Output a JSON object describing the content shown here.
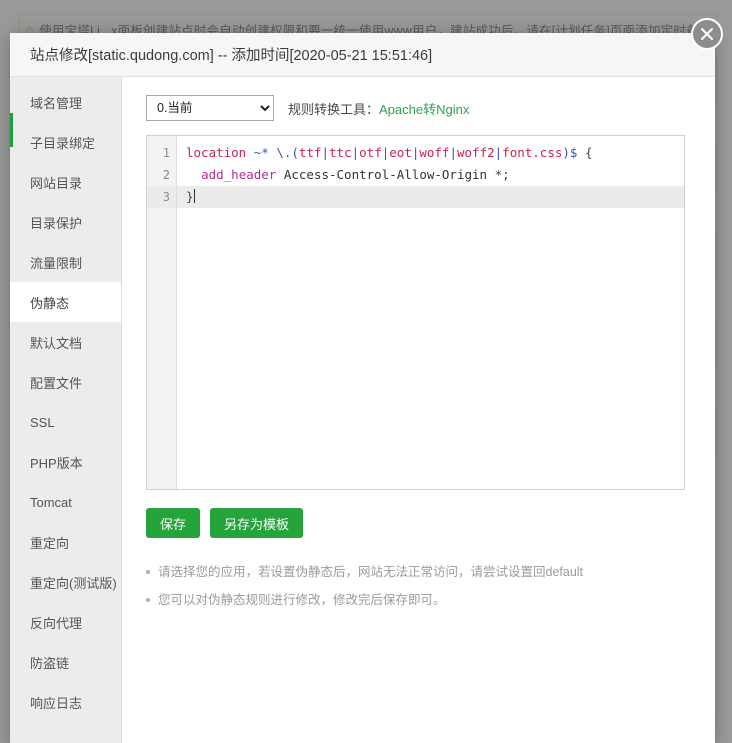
{
  "background": {
    "alert_icon": "warning-triangle-icon",
    "alert_text": "使用宝塔Li...x面板创建站点时会自动创建权限和要一统一使用www用户，建站成功后，请在[计划任务]页面添加定时备份任务",
    "alert_link": "[计划任务]"
  },
  "modal": {
    "title": "站点修改[static.qudong.com] -- 添加时间[2020-05-21 15:51:46]",
    "close_icon": "close-icon"
  },
  "sidebar": {
    "items": [
      {
        "label": "域名管理",
        "active": false
      },
      {
        "label": "子目录绑定",
        "active": false
      },
      {
        "label": "网站目录",
        "active": false
      },
      {
        "label": "目录保护",
        "active": false
      },
      {
        "label": "流量限制",
        "active": false
      },
      {
        "label": "伪静态",
        "active": true
      },
      {
        "label": "默认文档",
        "active": false
      },
      {
        "label": "配置文件",
        "active": false
      },
      {
        "label": "SSL",
        "active": false
      },
      {
        "label": "PHP版本",
        "active": false
      },
      {
        "label": "Tomcat",
        "active": false
      },
      {
        "label": "重定向",
        "active": false
      },
      {
        "label": "重定向(测试版)",
        "active": false
      },
      {
        "label": "反向代理",
        "active": false
      },
      {
        "label": "防盗链",
        "active": false
      },
      {
        "label": "响应日志",
        "active": false
      }
    ],
    "accent_color": "#1f9e3e"
  },
  "toolbar": {
    "select_value": "0.当前",
    "select_options": [
      "0.当前"
    ],
    "converter_label": "规则转换工具：",
    "converter_link": "Apache转Nginx",
    "converter_link_color": "#30a14e",
    "chevron_icon": "chevron-down-icon"
  },
  "editor": {
    "line_numbers": [
      "1",
      "2",
      "3"
    ],
    "active_line": 3,
    "lines": [
      [
        {
          "t": "location",
          "c": "kw"
        },
        {
          "t": " ",
          "c": "plain"
        },
        {
          "t": "~*",
          "c": "op"
        },
        {
          "t": " ",
          "c": "plain"
        },
        {
          "t": "\\.(",
          "c": "op"
        },
        {
          "t": "ttf",
          "c": "kw"
        },
        {
          "t": "|",
          "c": "op"
        },
        {
          "t": "ttc",
          "c": "kw"
        },
        {
          "t": "|",
          "c": "op"
        },
        {
          "t": "otf",
          "c": "kw"
        },
        {
          "t": "|",
          "c": "op"
        },
        {
          "t": "eot",
          "c": "kw"
        },
        {
          "t": "|",
          "c": "op"
        },
        {
          "t": "woff",
          "c": "kw"
        },
        {
          "t": "|",
          "c": "op"
        },
        {
          "t": "woff2",
          "c": "kw"
        },
        {
          "t": "|",
          "c": "op"
        },
        {
          "t": "font.css",
          "c": "kw"
        },
        {
          "t": ")$",
          "c": "op"
        },
        {
          "t": " {",
          "c": "punc"
        }
      ],
      [
        {
          "t": "  ",
          "c": "plain"
        },
        {
          "t": "add_header",
          "c": "fn"
        },
        {
          "t": " Access-Control-Allow-Origin ",
          "c": "plain"
        },
        {
          "t": "*;",
          "c": "punc"
        }
      ],
      [
        {
          "t": "}",
          "c": "punc"
        }
      ]
    ],
    "raw_text": "location ~* \\.(ttf|ttc|otf|eot|woff|woff2|font.css)$ {\n  add_header Access-Control-Allow-Origin *;\n}"
  },
  "buttons": {
    "save": "保存",
    "save_as_template": "另存为模板",
    "color": "#24a43a"
  },
  "notes": [
    "请选择您的应用，若设置伪静态后，网站无法正常访问，请尝试设置回default",
    "您可以对伪静态规则进行修改，修改完后保存即可。"
  ]
}
